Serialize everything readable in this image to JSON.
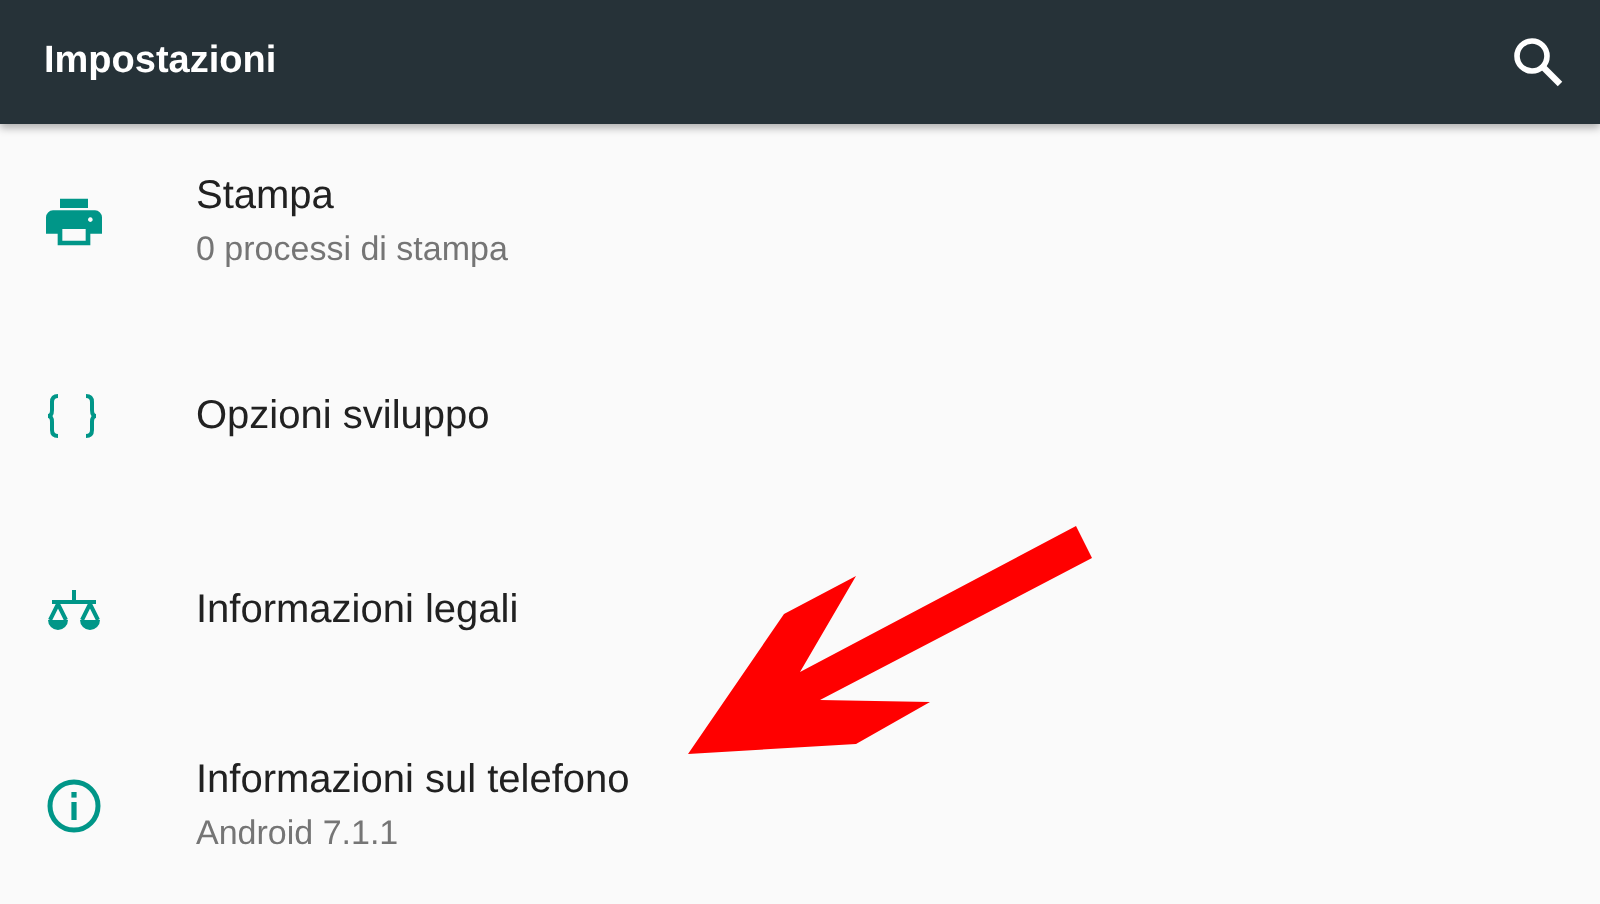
{
  "app_bar": {
    "title": "Impostazioni"
  },
  "settings": [
    {
      "kind": "print",
      "title": "Stampa",
      "subtitle": "0 processi di stampa"
    },
    {
      "kind": "developer",
      "title": "Opzioni sviluppo"
    },
    {
      "kind": "legal",
      "title": "Informazioni legali"
    },
    {
      "kind": "info",
      "title": "Informazioni sul telefono",
      "subtitle": "Android 7.1.1"
    }
  ]
}
